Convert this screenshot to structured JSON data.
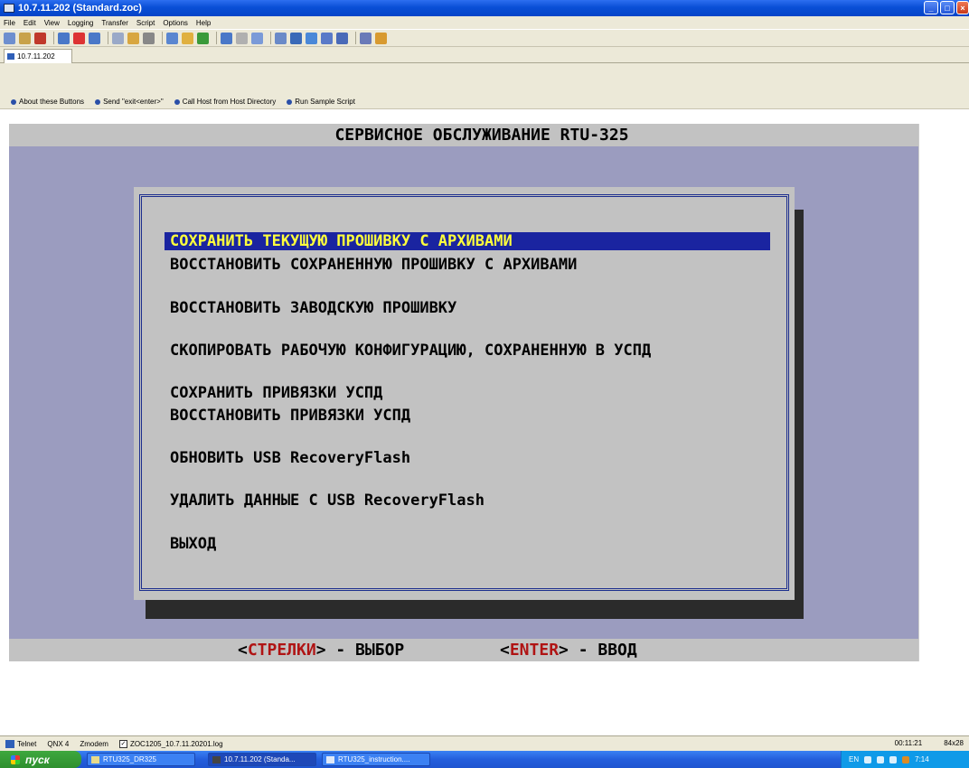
{
  "window": {
    "title": "10.7.11.202 (Standard.zoc)",
    "controls": [
      "_",
      "□",
      "×"
    ]
  },
  "menubar": [
    "File",
    "Edit",
    "View",
    "Logging",
    "Transfer",
    "Script",
    "Options",
    "Help"
  ],
  "session_tab": {
    "label": "10.7.11.202"
  },
  "buttonbar": [
    "About these Buttons",
    "Send \"exit<enter>\"",
    "Call Host from Host Directory",
    "Run Sample Script"
  ],
  "terminal": {
    "header": "СЕРВИСНОЕ ОБСЛУЖИВАНИЕ RTU-325",
    "menu": [
      "СОХРАНИТЬ ТЕКУЩУЮ ПРОШИВКУ С АРХИВАМИ",
      "ВОССТАНОВИТЬ СОХРАНЕННУЮ ПРОШИВКУ С АРХИВАМИ",
      "ВОССТАНОВИТЬ ЗАВОДСКУЮ ПРОШИВКУ",
      "СКОПИРОВАТЬ РАБОЧУЮ КОНФИГУРАЦИЮ, СОХРАНЕННУЮ В УСПД",
      "СОХРАНИТЬ ПРИВЯЗКИ УСПД",
      "ВОССТАНОВИТЬ ПРИВЯЗКИ УСПД",
      "ОБНОВИТЬ USB RecoveryFlash",
      "УДАЛИТЬ ДАННЫЕ С USB RecoveryFlash",
      "ВЫХОД"
    ],
    "selected_index": 0,
    "footer": {
      "arrows_open": "<",
      "arrows_key": "СТРЕЛКИ",
      "arrows_close": ">",
      "arrows_action": " - ВЫБОР",
      "enter_open": "<",
      "enter_key": "ENTER",
      "enter_close": ">",
      "enter_action": " - ВВОД"
    }
  },
  "statusbar": {
    "emulation": "Telnet",
    "terminal_type": "QNX 4",
    "transfer": "Zmodem",
    "logfile": "ZOC1205_10.7.11.20201.log",
    "logfile_checked": true,
    "time": "00:11:21",
    "size": "84x28"
  },
  "taskbar": {
    "start_label": "пуск",
    "tasks": [
      "RTU325_DR325",
      "10.7.11.202 (Standa...",
      "RTU325_instruction...."
    ],
    "active_task": 1,
    "tray_lang": "EN",
    "clock": "7:14"
  },
  "colors": {
    "terminal_bg": "#9b9cbf",
    "dialog_bg": "#c2c2c2",
    "selection_bg": "#1a24a0",
    "selection_fg": "#ffff3c",
    "key_red": "#b01414",
    "frame_blue": "#1c2e8e"
  }
}
